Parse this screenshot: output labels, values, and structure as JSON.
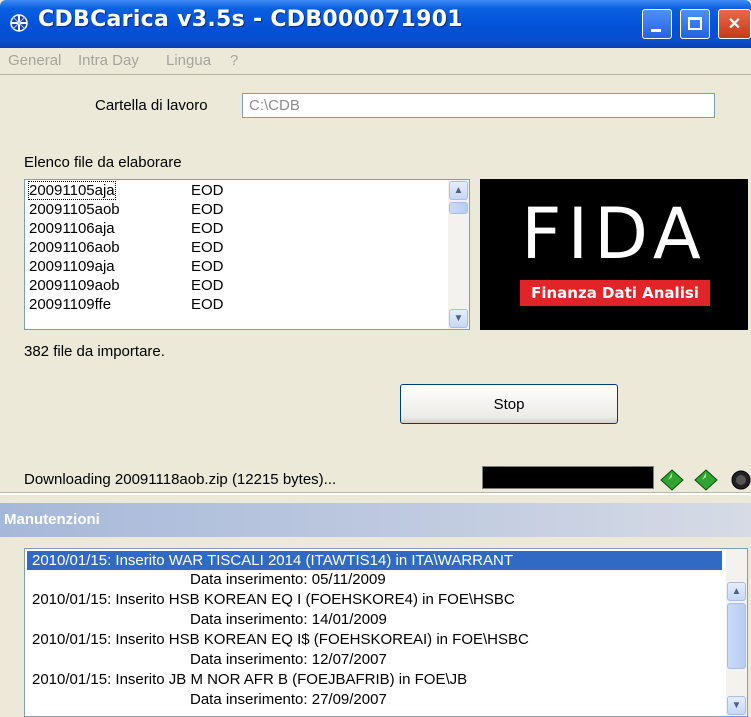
{
  "window": {
    "title": "CDBCarica v3.5s - CDB000071901",
    "controls": {
      "minimize": "minimize",
      "maximize": "maximize",
      "close": "✕"
    }
  },
  "menu": [
    "General",
    "Intra Day",
    "Lingua",
    "?"
  ],
  "workdir": {
    "label": "Cartella di lavoro",
    "value": "C:\\CDB"
  },
  "filelist": {
    "label": "Elenco file da elaborare",
    "files": [
      {
        "name": "20091105aja",
        "type": "EOD"
      },
      {
        "name": "20091105aob",
        "type": "EOD"
      },
      {
        "name": "20091106aja",
        "type": "EOD"
      },
      {
        "name": "20091106aob",
        "type": "EOD"
      },
      {
        "name": "20091109aja",
        "type": "EOD"
      },
      {
        "name": "20091109aob",
        "type": "EOD"
      },
      {
        "name": "20091109ffe",
        "type": "EOD"
      }
    ],
    "count_text": "382 file da importare."
  },
  "logo": {
    "main": "FIDA",
    "band": "Finanza Dati Analisi",
    "colors": {
      "bg": "#000000",
      "band": "#e02428"
    }
  },
  "stop_label": "Stop",
  "status": {
    "text": "Downloading 20091118aob.zip  (12215 bytes)...",
    "progress": 0
  },
  "maintenance": {
    "title": "Manutenzioni",
    "entries": [
      {
        "line": "2010/01/15: Inserito WAR TISCALI 2014 (ITAWTIS14) in ITA\\WARRANT",
        "date": "Data inserimento: 05/11/2009"
      },
      {
        "line": "2010/01/15: Inserito HSB KOREAN EQ I (FOEHSKORE4) in FOE\\HSBC",
        "date": "Data inserimento: 14/01/2009"
      },
      {
        "line": "2010/01/15: Inserito HSB KOREAN EQ I$ (FOEHSKOREAI) in FOE\\HSBC",
        "date": "Data inserimento: 12/07/2007"
      },
      {
        "line": "2010/01/15: Inserito JB M NOR AFR B (FOEJBAFRIB) in FOE\\JB",
        "date": "Data inserimento: 27/09/2007"
      }
    ]
  },
  "colors": {
    "titlebar": "#0250d6",
    "selection": "#316ac5",
    "face": "#ece9d8",
    "led_green": "#2fa52f"
  }
}
